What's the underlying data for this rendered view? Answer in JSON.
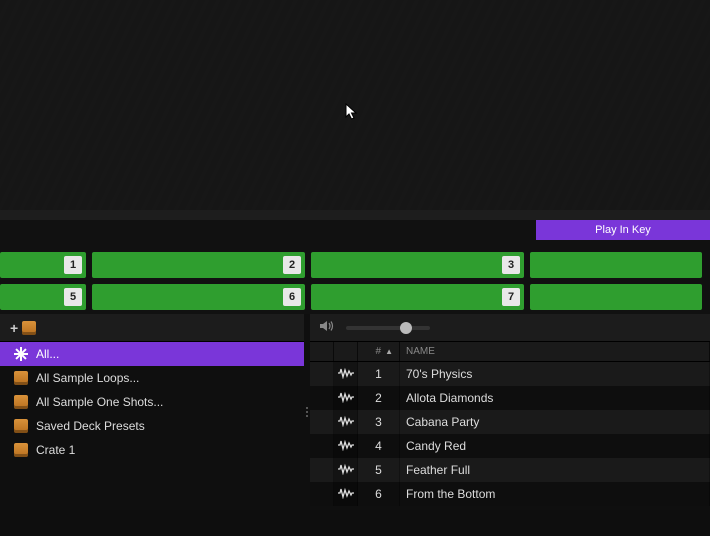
{
  "toolbar": {
    "play_in_key_label": "Play In Key"
  },
  "pads": {
    "row1": [
      "1",
      "2",
      "3",
      ""
    ],
    "row2": [
      "5",
      "6",
      "7",
      ""
    ]
  },
  "sidebar": {
    "add_crate_tooltip": "Add Crate",
    "items": [
      {
        "label": "All...",
        "icon": "spark",
        "selected": true
      },
      {
        "label": "All Sample Loops...",
        "icon": "crate",
        "selected": false
      },
      {
        "label": "All Sample One Shots...",
        "icon": "crate",
        "selected": false
      },
      {
        "label": "Saved Deck Presets",
        "icon": "crate",
        "selected": false
      },
      {
        "label": "Crate 1",
        "icon": "crate",
        "selected": false
      }
    ]
  },
  "volume": {
    "value_percent": 72
  },
  "table": {
    "columns": {
      "num": "#",
      "name": "NAME"
    },
    "sort": {
      "column": "#",
      "direction": "asc"
    },
    "rows": [
      {
        "num": "1",
        "name": "70's Physics"
      },
      {
        "num": "2",
        "name": "Allota Diamonds"
      },
      {
        "num": "3",
        "name": "Cabana Party"
      },
      {
        "num": "4",
        "name": "Candy Red"
      },
      {
        "num": "5",
        "name": "Feather Full"
      },
      {
        "num": "6",
        "name": "From the Bottom"
      }
    ]
  }
}
